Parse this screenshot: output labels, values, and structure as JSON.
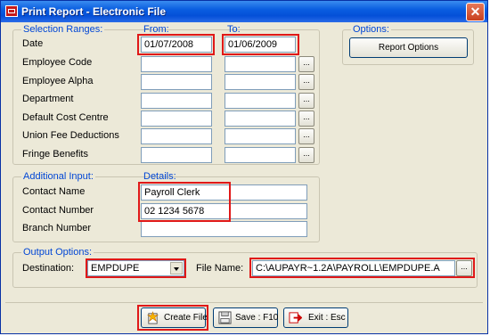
{
  "window": {
    "title": "Print Report - Electronic File",
    "close_glyph": "✕"
  },
  "selection": {
    "heading": "Selection Ranges:",
    "from_label": "From:",
    "to_label": "To:",
    "rows": [
      {
        "label": "Date",
        "from": "01/07/2008",
        "to": "01/06/2009"
      },
      {
        "label": "Employee Code",
        "from": "",
        "to": ""
      },
      {
        "label": "Employee Alpha",
        "from": "",
        "to": ""
      },
      {
        "label": "Department",
        "from": "",
        "to": ""
      },
      {
        "label": "Default Cost Centre",
        "from": "",
        "to": ""
      },
      {
        "label": "Union Fee Deductions",
        "from": "",
        "to": ""
      },
      {
        "label": "Fringe Benefits",
        "from": "",
        "to": ""
      }
    ],
    "lookup_label": "..."
  },
  "options": {
    "heading": "Options:",
    "report_options_label": "Report Options"
  },
  "additional": {
    "heading": "Additional Input:",
    "details_label": "Details:",
    "contact_name_label": "Contact Name",
    "contact_name_value": "Payroll Clerk",
    "contact_number_label": "Contact Number",
    "contact_number_value": "02 1234 5678",
    "branch_number_label": "Branch Number",
    "branch_number_value": ""
  },
  "output": {
    "heading": "Output Options:",
    "destination_label": "Destination:",
    "destination_value": "EMPDUPE",
    "file_name_label": "File Name:",
    "file_name_value": "C:\\AUPAYR~1.2A\\PAYROLL\\EMPDUPE.A",
    "browse_label": "..."
  },
  "buttons": {
    "create": "Create File",
    "save": "Save : F10",
    "exit": "Exit : Esc"
  },
  "icons": {
    "app": "app-icon",
    "create": "create-file-icon",
    "save": "save-icon",
    "exit": "exit-icon"
  },
  "colors": {
    "highlight": "#e01818",
    "group_label": "#0046d5",
    "title_bar": "#0a5ee0"
  }
}
